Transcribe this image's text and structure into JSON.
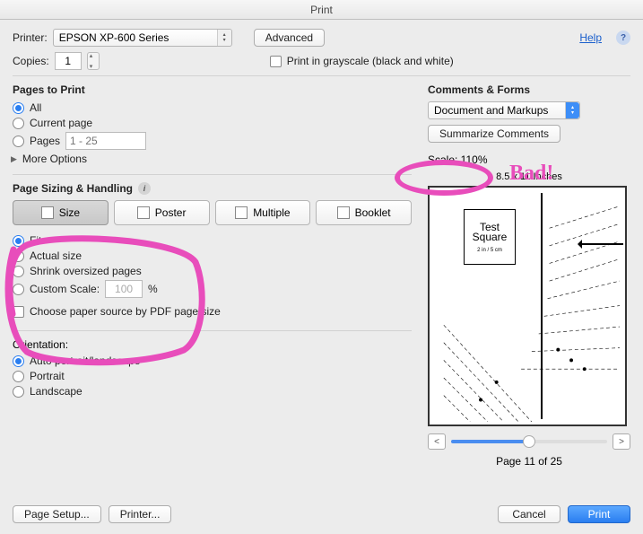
{
  "window": {
    "title": "Print"
  },
  "header": {
    "printer_label": "Printer:",
    "printer_value": "EPSON XP-600 Series",
    "advanced": "Advanced",
    "help": "Help",
    "copies_label": "Copies:",
    "copies_value": "1",
    "grayscale": "Print in grayscale (black and white)"
  },
  "pages_to_print": {
    "title": "Pages to Print",
    "all": "All",
    "current": "Current page",
    "pages": "Pages",
    "pages_placeholder": "1 - 25",
    "more_options": "More Options"
  },
  "sizing": {
    "title": "Page Sizing & Handling",
    "size": "Size",
    "poster": "Poster",
    "multiple": "Multiple",
    "booklet": "Booklet",
    "fit": "Fit",
    "actual": "Actual size",
    "shrink": "Shrink oversized pages",
    "custom": "Custom Scale:",
    "custom_val": "100",
    "pct": "%",
    "choose_paper": "Choose paper source by PDF page size"
  },
  "orientation": {
    "title": "Orientation:",
    "auto": "Auto portrait/landscape",
    "portrait": "Portrait",
    "landscape": "Landscape"
  },
  "comments": {
    "title": "Comments & Forms",
    "dropdown": "Document and Markups",
    "summarize": "Summarize Comments",
    "scale": "Scale: 110%",
    "paper": "8.5 x 11 Inches"
  },
  "preview": {
    "test_square_line1": "Test",
    "test_square_line2": "Square",
    "test_square_sub": "2 in / 5 cm",
    "page_of": "Page 11 of 25"
  },
  "footer": {
    "page_setup": "Page Setup...",
    "printer_btn": "Printer...",
    "cancel": "Cancel",
    "print": "Print"
  },
  "annotation": {
    "bad": "Bad!"
  }
}
